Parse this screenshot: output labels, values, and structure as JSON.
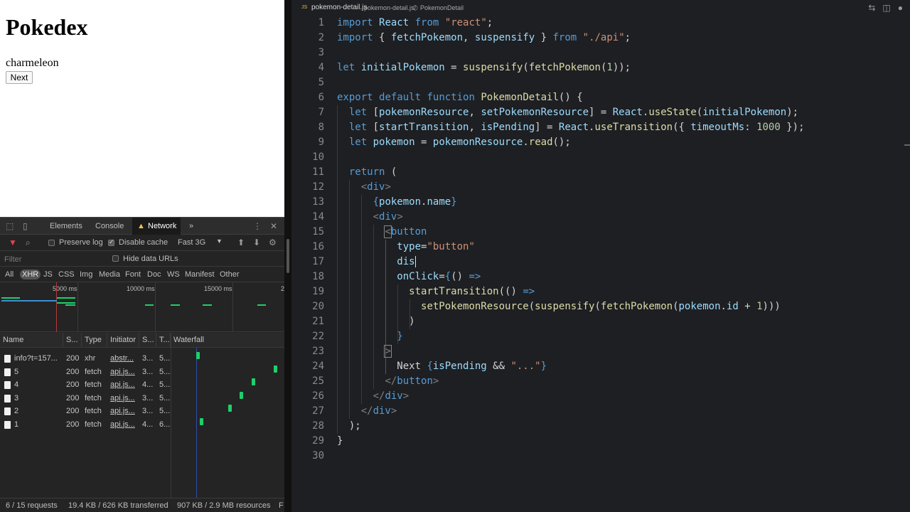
{
  "browser": {
    "heading": "Pokedex",
    "pokemon_name": "charmeleon",
    "next_button": "Next"
  },
  "devtools": {
    "tabs": [
      "Elements",
      "Console",
      "Network"
    ],
    "active_tab": "Network",
    "more_tabs_icon": "»",
    "toolbar": {
      "preserve_log": "Preserve log",
      "disable_cache": "Disable cache",
      "throttling": "Fast 3G"
    },
    "filter_placeholder": "Filter",
    "hide_data_urls": "Hide data URLs",
    "types": [
      "All",
      "XHR",
      "JS",
      "CSS",
      "Img",
      "Media",
      "Font",
      "Doc",
      "WS",
      "Manifest",
      "Other"
    ],
    "active_type": "XHR",
    "timeline_ticks": [
      "5000 ms",
      "10000 ms",
      "15000 ms",
      "2"
    ],
    "columns": [
      "Name",
      "S...",
      "Type",
      "Initiator",
      "S...",
      "T...",
      "Waterfall"
    ],
    "rows": [
      {
        "name": "info?t=157...",
        "status": "200",
        "type": "xhr",
        "initiator": "abstr...",
        "size": "3...",
        "time": "5...",
        "wf": 0.23
      },
      {
        "name": "5",
        "status": "200",
        "type": "fetch",
        "initiator": "api.js...",
        "size": "3...",
        "time": "5...",
        "wf": 0.91
      },
      {
        "name": "4",
        "status": "200",
        "type": "fetch",
        "initiator": "api.js...",
        "size": "4...",
        "time": "5...",
        "wf": 0.72
      },
      {
        "name": "3",
        "status": "200",
        "type": "fetch",
        "initiator": "api.js...",
        "size": "3...",
        "time": "5...",
        "wf": 0.61
      },
      {
        "name": "2",
        "status": "200",
        "type": "fetch",
        "initiator": "api.js...",
        "size": "3...",
        "time": "5...",
        "wf": 0.51
      },
      {
        "name": "1",
        "status": "200",
        "type": "fetch",
        "initiator": "api.js...",
        "size": "4...",
        "time": "6...",
        "wf": 0.26
      }
    ],
    "status": {
      "requests": "6 / 15 requests",
      "transferred": "19.4 KB / 626 KB transferred",
      "resources": "907 KB / 2.9 MB resources",
      "finish": "F"
    },
    "colors": {
      "waterfall_bar": "#1ecf6b",
      "active_tab_warning": "#f2c14e"
    }
  },
  "editor": {
    "breadcrumb": {
      "file_badge": "JS",
      "file": "pokemon-detail.js",
      "path": "pokemon-detail.js/",
      "symbol": "PokemonDetail"
    },
    "line_numbers": [
      "1",
      "2",
      "3",
      "4",
      "5",
      "6",
      "7",
      "8",
      "9",
      "10",
      "11",
      "12",
      "13",
      "14",
      "15",
      "16",
      "17",
      "18",
      "19",
      "20",
      "21",
      "22",
      "23",
      "24",
      "25",
      "26",
      "27",
      "28",
      "29",
      "30"
    ]
  }
}
